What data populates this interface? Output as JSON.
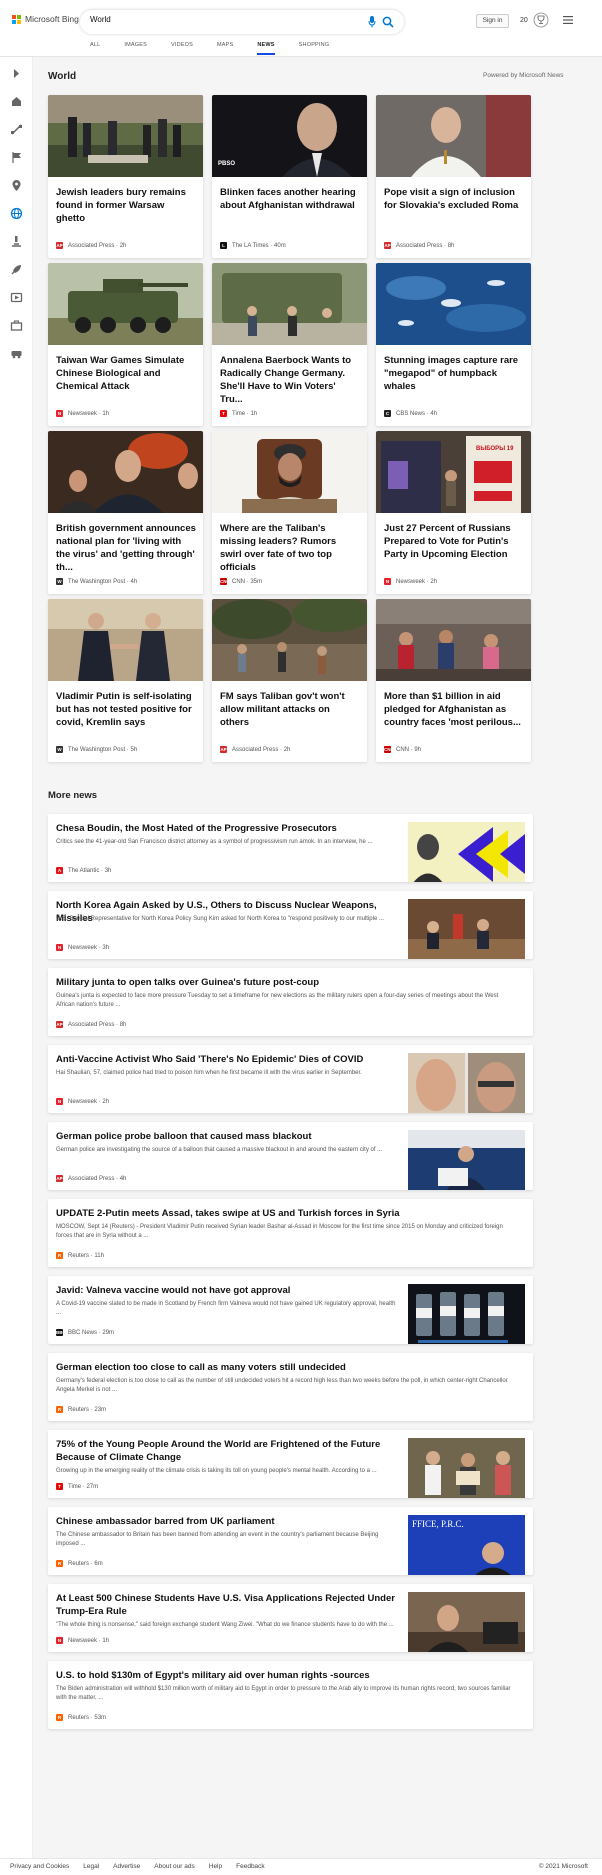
{
  "header": {
    "brand": "Microsoft Bing",
    "logo_colors": [
      "#f25022",
      "#7fba00",
      "#00a4ef",
      "#ffb900"
    ],
    "search_value": "World",
    "sign_in": "Sign in",
    "rewards_count": "20",
    "tabs": [
      "ALL",
      "IMAGES",
      "VIDEOS",
      "MAPS",
      "NEWS",
      "SHOPPING"
    ],
    "active_tab": "NEWS"
  },
  "rail": {
    "icons": [
      "expand-icon",
      "home-icon",
      "fitness-icon",
      "flag-icon",
      "location-icon",
      "globe-icon",
      "microscope-icon",
      "rocket-icon",
      "entertainment-icon",
      "briefcase-icon",
      "car-icon"
    ]
  },
  "world": {
    "title": "World",
    "powered_by": "Powered by Microsoft News",
    "cards": [
      {
        "title": "Jewish leaders bury remains found in former Warsaw ghetto",
        "source": "Associated Press",
        "time": "2h",
        "logo": "AP",
        "logo_color": "#d12b2b"
      },
      {
        "title": "Blinken faces another hearing about Afghanistan withdrawal",
        "source": "The LA Times",
        "time": "40m",
        "logo": "L",
        "logo_color": "#111111",
        "image_text": "PBSO"
      },
      {
        "title": "Pope visit a sign of inclusion for Slovakia's excluded Roma",
        "source": "Associated Press",
        "time": "8h",
        "logo": "AP",
        "logo_color": "#d12b2b"
      },
      {
        "title": "Taiwan War Games Simulate Chinese Biological and Chemical Attack",
        "source": "Newsweek",
        "time": "1h",
        "logo": "N",
        "logo_color": "#e4232c"
      },
      {
        "title": "Annalena Baerbock Wants to Radically Change Germany. She'll Have to Win Voters' Tru...",
        "source": "Time",
        "time": "1h",
        "logo": "T",
        "logo_color": "#e90606"
      },
      {
        "title": "Stunning images capture rare \"megapod\" of humpback whales",
        "source": "CBS News",
        "time": "4h",
        "logo": "C",
        "logo_color": "#222222"
      },
      {
        "title": "British government announces national plan for 'living with the virus' and 'getting through' th...",
        "source": "The Washington Post",
        "time": "4h",
        "logo": "W",
        "logo_color": "#333333"
      },
      {
        "title": "Where are the Taliban's missing leaders? Rumors swirl over fate of two top officials",
        "source": "CNN",
        "time": "35m",
        "logo": "CNN",
        "logo_color": "#cc0000"
      },
      {
        "title": "Just 27 Percent of Russians Prepared to Vote for Putin's Party in Upcoming Election",
        "source": "Newsweek",
        "time": "2h",
        "logo": "N",
        "logo_color": "#e4232c",
        "image_text": "ВЫБОРЫ 19"
      },
      {
        "title": "Vladimir Putin is self-isolating but has not tested positive for covid, Kremlin says",
        "source": "The Washington Post",
        "time": "5h",
        "logo": "W",
        "logo_color": "#333333"
      },
      {
        "title": "FM says Taliban gov't won't allow militant attacks on others",
        "source": "Associated Press",
        "time": "2h",
        "logo": "AP",
        "logo_color": "#d12b2b"
      },
      {
        "title": "More than $1 billion in aid pledged for Afghanistan as country faces 'most perilous...",
        "source": "CNN",
        "time": "9h",
        "logo": "CNN",
        "logo_color": "#cc0000"
      }
    ]
  },
  "more_news": {
    "title": "More news",
    "items": [
      {
        "title": "Chesa Boudin, the Most Hated of the Progressive Prosecutors",
        "snippet": "Critics see the 41-year-old San Francisco district attorney as a symbol of progressivism run amok. In an interview, he ...",
        "source": "The Atlantic",
        "time": "3h",
        "logo": "A",
        "logo_color": "#e7131a"
      },
      {
        "title": "North Korea Again Asked by U.S., Others to Discuss Nuclear Weapons, Missiles",
        "snippet": "U.S. Special Representative for North Korea Policy Sung Kim asked for North Korea to \"respond positively to our multiple ...",
        "source": "Newsweek",
        "time": "3h",
        "logo": "N",
        "logo_color": "#e4232c"
      },
      {
        "title": "Military junta to open talks over Guinea's future post-coup",
        "snippet": "Guinea's junta is expected to face more pressure Tuesday to set a timeframe for new elections as the military rulers open a four-day series of meetings about the West African nation's future ...",
        "source": "Associated Press",
        "time": "8h",
        "logo": "AP",
        "logo_color": "#d12b2b"
      },
      {
        "title": "Anti-Vaccine Activist Who Said 'There's No Epidemic' Dies of COVID",
        "snippet": "Hai Shaulian, 57, claimed police had tried to poison him when he first became ill with the virus earlier in September.",
        "source": "Newsweek",
        "time": "2h",
        "logo": "N",
        "logo_color": "#e4232c"
      },
      {
        "title": "German police probe balloon that caused mass blackout",
        "snippet": "German police are investigating the source of a balloon that caused a massive blackout in and around the eastern city of ...",
        "source": "Associated Press",
        "time": "4h",
        "logo": "AP",
        "logo_color": "#d12b2b"
      },
      {
        "title": "UPDATE 2-Putin meets Assad, takes swipe at US and Turkish forces in Syria",
        "snippet": "MOSCOW, Sept 14 (Reuters) - President Vladimir Putin received Syrian leader Bashar al-Assad in Moscow for the first time since 2015 on Monday and criticized foreign forces that are in Syria without a ...",
        "source": "Reuters",
        "time": "11h",
        "logo": "R",
        "logo_color": "#fa6400"
      },
      {
        "title": "Javid: Valneva vaccine would not have got approval",
        "snippet": "A Covid-19 vaccine slated to be made in Scotland by French firm Valneva would not have gained UK regulatory approval, health ...",
        "source": "BBC News",
        "time": "29m",
        "logo": "BBC",
        "logo_color": "#111111"
      },
      {
        "title": "German election too close to call as many voters still undecided",
        "snippet": "Germany's federal election is too close to call as the number of still undecided voters hit a record high less than two weeks before the poll, in which center-right Chancellor Angela Merkel is not ...",
        "source": "Reuters",
        "time": "23m",
        "logo": "R",
        "logo_color": "#fa6400"
      },
      {
        "title": "75% of the Young People Around the World are Frightened of the Future Because of Climate Change",
        "snippet": "Growing up in the emerging reality of the climate crisis is taking its toll on young people's mental health. According to a ...",
        "source": "Time",
        "time": "27m",
        "logo": "T",
        "logo_color": "#e90606"
      },
      {
        "title": "Chinese ambassador barred from UK parliament",
        "snippet": "The Chinese ambassador to Britain has been banned from attending an event in the country's parliament because Beijing imposed ...",
        "source": "Reuters",
        "time": "6m",
        "logo": "R",
        "logo_color": "#fa6400",
        "image_text": "FFICE, P.R.C."
      },
      {
        "title": "At Least 500 Chinese Students Have U.S. Visa Applications Rejected Under Trump-Era Rule",
        "snippet": "\"The whole thing is nonsense,\" said foreign exchange student Wang Ziwei. \"What do we finance students have to do with the ...",
        "source": "Newsweek",
        "time": "1h",
        "logo": "N",
        "logo_color": "#e4232c"
      },
      {
        "title": "U.S. to hold $130m of Egypt's military aid over human rights -sources",
        "snippet": "The Biden administration will withhold $130 million worth of military aid to Egypt in order to pressure to the Arab ally to improve its human rights record, two sources familiar with the matter, ...",
        "source": "Reuters",
        "time": "53m",
        "logo": "R",
        "logo_color": "#fa6400"
      }
    ]
  },
  "footer": {
    "links": [
      "Privacy and Cookies",
      "Legal",
      "Advertise",
      "About our ads",
      "Help",
      "Feedback"
    ],
    "copyright": "© 2021 Microsoft"
  }
}
